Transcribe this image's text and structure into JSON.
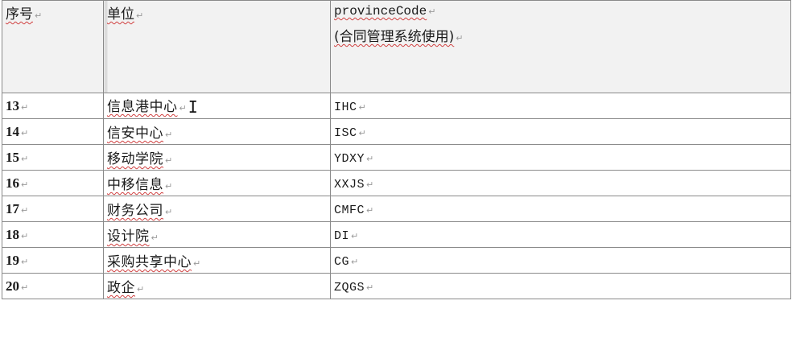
{
  "header": {
    "col_num": "序号",
    "col_unit": "单位",
    "col_code": "provinceCode",
    "col_code_sub": "(合同管理系统使用)"
  },
  "para_mark": "↵",
  "rows": [
    {
      "num": "13",
      "unit": "信息港中心",
      "code": "IHC"
    },
    {
      "num": "14",
      "unit": "信安中心",
      "code": "ISC"
    },
    {
      "num": "15",
      "unit": "移动学院",
      "code": "YDXY"
    },
    {
      "num": "16",
      "unit": "中移信息",
      "code": "XXJS"
    },
    {
      "num": "17",
      "unit": "财务公司",
      "code": "CMFC"
    },
    {
      "num": "18",
      "unit": "设计院",
      "code": "DI"
    },
    {
      "num": "19",
      "unit": "采购共享中心",
      "code": "CG"
    },
    {
      "num": "20",
      "unit": "政企",
      "code": "ZQGS"
    }
  ],
  "icons": {
    "text_cursor": "text-cursor-icon"
  }
}
